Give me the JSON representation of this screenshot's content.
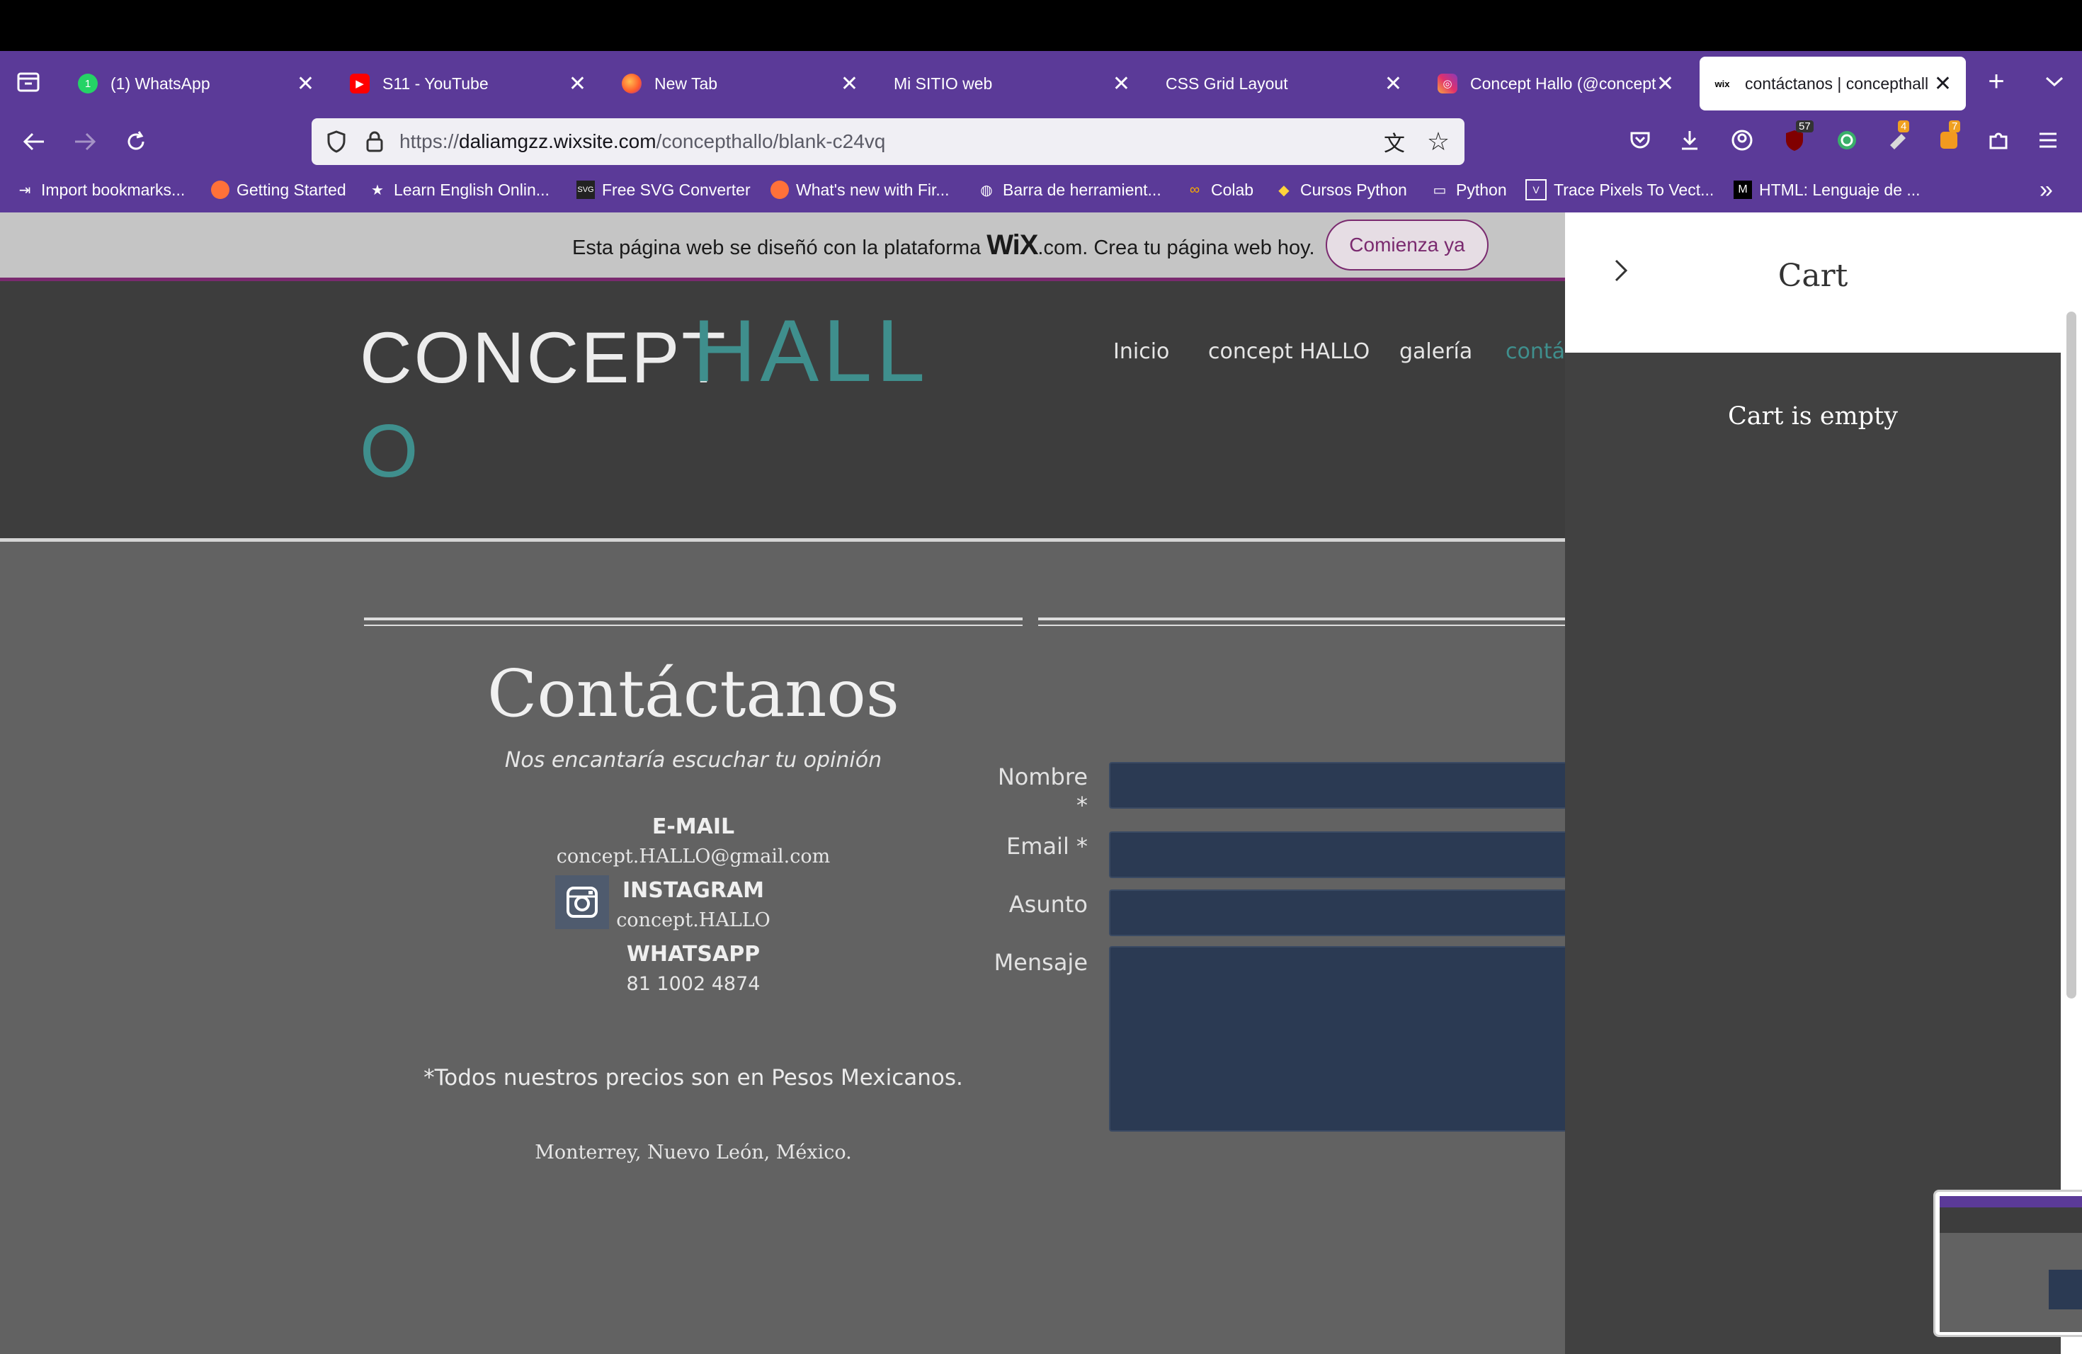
{
  "tabs": [
    {
      "title": "(1) WhatsApp",
      "icon": "whatsapp-icon",
      "color": "#25d366"
    },
    {
      "title": "S11 - YouTube",
      "icon": "youtube-icon",
      "color": "#ff0000"
    },
    {
      "title": "New Tab",
      "icon": "firefox-icon",
      "color": "#ff7139"
    },
    {
      "title": "Mi SITIO web",
      "icon": "",
      "color": ""
    },
    {
      "title": "CSS Grid Layout",
      "icon": "",
      "color": ""
    },
    {
      "title": "Concept Hallo (@concept",
      "icon": "instagram-icon",
      "color": "#e1306c"
    },
    {
      "title": "contáctanos | concepthall",
      "icon": "wix-icon",
      "color": "#000000",
      "active": true
    }
  ],
  "url": {
    "prefix": "https://",
    "domain": "daliamgzz.wixsite.com",
    "path": "/concepthallo/blank-c24vq"
  },
  "extension_badges": {
    "ublock": "57",
    "ext1": "4",
    "ext2": "7"
  },
  "bookmarks": [
    "Import bookmarks...",
    "Getting Started",
    "Learn English Onlin...",
    "Free SVG Converter",
    "What's new with Fir...",
    "Barra de herramient...",
    "Colab",
    "Cursos Python",
    "Python",
    "Trace Pixels To Vect...",
    "HTML: Lenguaje de ..."
  ],
  "wix_banner": {
    "text_before": "Esta página web se diseñó con la plataforma ",
    "brand": "WiX",
    "text_after": ".com. Crea tu página web hoy.",
    "button": "Comienza ya"
  },
  "site": {
    "logo_part1": "CONCEPT",
    "logo_part2": "HALL",
    "logo_part3": "O",
    "menu": [
      "Inicio",
      "concept HALLO",
      "galería",
      "contá"
    ]
  },
  "contact": {
    "title": "Contáctanos",
    "subtitle": "Nos encantaría escuchar tu opinión",
    "email_label": "E-MAIL",
    "email_value": "concept.HALLO@gmail.com",
    "instagram_label": "INSTAGRAM",
    "instagram_value": "concept.HALLO",
    "whatsapp_label": "WHATSAPP",
    "whatsapp_value": "81 1002 4874",
    "prices_note": "*Todos nuestros precios son en Pesos Mexicanos.",
    "location": "Monterrey, Nuevo León, México."
  },
  "form": {
    "name_label": "Nombre",
    "name_required": "*",
    "email_label": "Email *",
    "subject_label": "Asunto",
    "message_label": "Mensaje"
  },
  "cart": {
    "title": "Cart",
    "empty_text": "Cart is empty"
  },
  "colors": {
    "browser_chrome": "#5b3a98",
    "accent_teal": "#3f8f8d",
    "wix_purple": "#7a2a6f",
    "field_bg": "#2b3a53"
  }
}
